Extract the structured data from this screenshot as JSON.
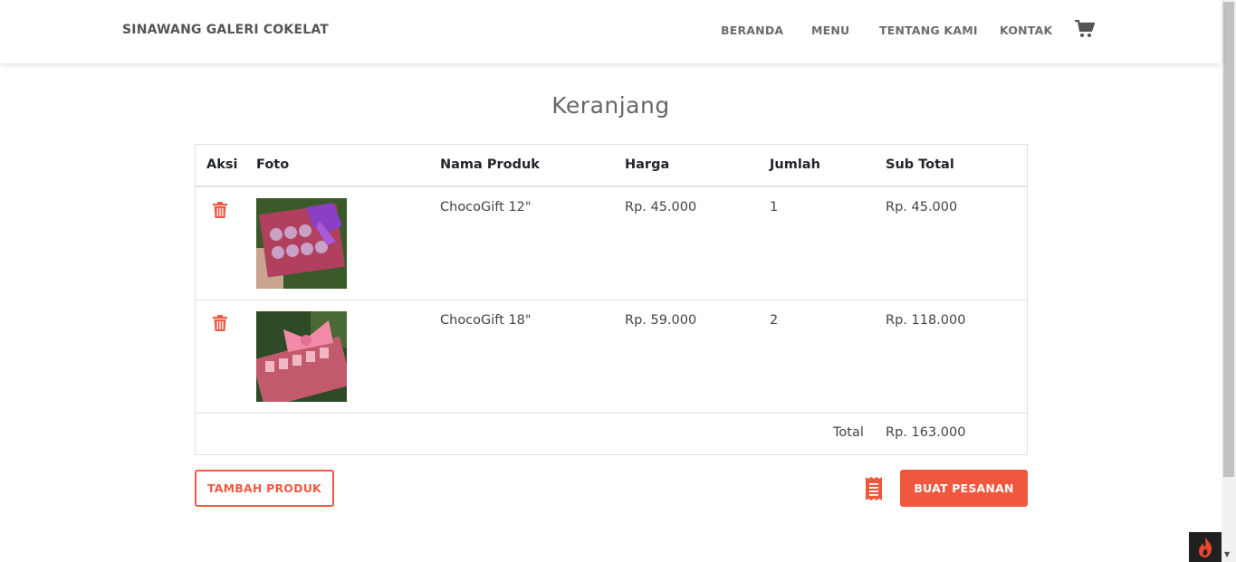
{
  "navbar": {
    "brand": "SINAWANG GALERI COKELAT",
    "links": [
      "BERANDA",
      "MENU",
      "TENTANG KAMI",
      "KONTAK"
    ],
    "cart_icon": "shopping-cart-icon"
  },
  "page_title": "Keranjang",
  "table": {
    "headers": [
      "Aksi",
      "Foto",
      "Nama Produk",
      "Harga",
      "Jumlah",
      "Sub Total"
    ],
    "rows": [
      {
        "name": "ChocoGift 12\"",
        "price": "Rp. 45.000",
        "qty": "1",
        "subtotal": "Rp. 45.000",
        "photo_color": "#b0405e"
      },
      {
        "name": "ChocoGift 18\"",
        "price": "Rp. 59.000",
        "qty": "2",
        "subtotal": "Rp. 118.000",
        "photo_color": "#d96a86"
      }
    ],
    "total_label": "Total",
    "total_value": "Rp. 163.000"
  },
  "actions": {
    "add_product": "TAMBAH PRODUK",
    "place_order": "BUAT PESANAN",
    "receipt_icon": "receipt-icon"
  },
  "colors": {
    "accent": "#f0573f",
    "trash": "#ee5a45"
  }
}
